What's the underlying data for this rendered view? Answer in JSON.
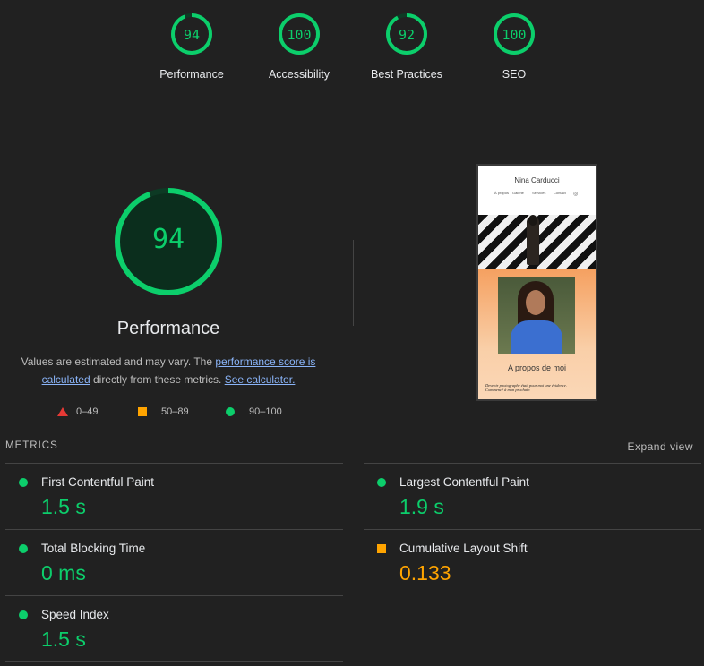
{
  "top_gauges": [
    {
      "score": "94",
      "label": "Performance",
      "fraction": 0.94
    },
    {
      "score": "100",
      "label": "Accessibility",
      "fraction": 1.0
    },
    {
      "score": "92",
      "label": "Best Practices",
      "fraction": 0.92
    },
    {
      "score": "100",
      "label": "SEO",
      "fraction": 1.0
    }
  ],
  "main": {
    "score": "94",
    "fraction": 0.94,
    "title": "Performance",
    "desc_part1": "Values are estimated and may vary. The ",
    "link_score": "performance score is calculated",
    "desc_part2": " directly from these metrics. ",
    "link_calc": "See calculator."
  },
  "legend": {
    "fail": "0–49",
    "average": "50–89",
    "pass": "90–100"
  },
  "screenshot": {
    "site_name": "Nina Carducci",
    "nav": [
      "À propos",
      "Galerie",
      "Services",
      "Contact"
    ],
    "about_title": "A propos de moi",
    "about_text": "Devenir photographe était pour moi une évidence. Commencé à mon prochain"
  },
  "metrics_section": {
    "header": "METRICS",
    "expand": "Expand view"
  },
  "metrics": [
    {
      "name": "First Contentful Paint",
      "value": "1.5 s",
      "status": "pass"
    },
    {
      "name": "Largest Contentful Paint",
      "value": "1.9 s",
      "status": "pass"
    },
    {
      "name": "Total Blocking Time",
      "value": "0 ms",
      "status": "pass"
    },
    {
      "name": "Cumulative Layout Shift",
      "value": "0.133",
      "status": "average"
    },
    {
      "name": "Speed Index",
      "value": "1.5 s",
      "status": "pass"
    }
  ],
  "colors": {
    "pass": "#0cce6b",
    "average": "#ffa400",
    "fail": "#e53935",
    "background": "#212121"
  }
}
